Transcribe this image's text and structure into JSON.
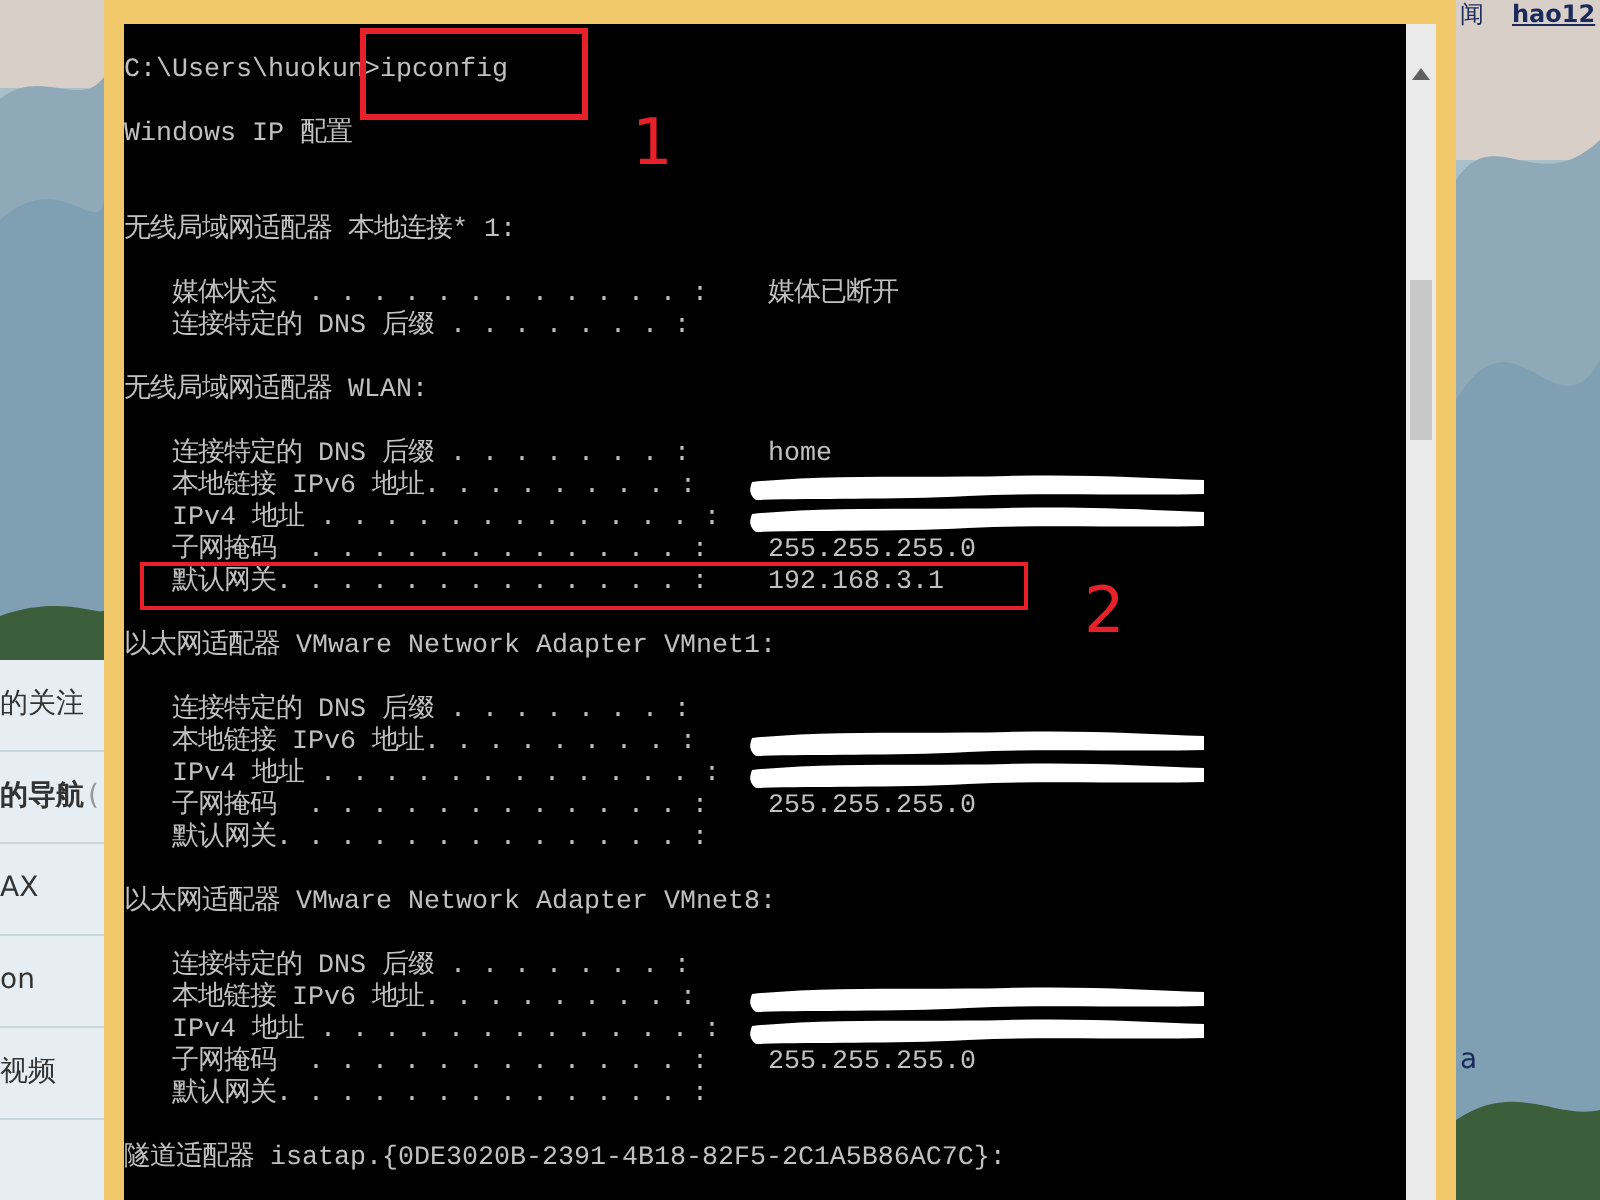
{
  "left_panel": {
    "items": [
      {
        "label": "的关注",
        "bold": false
      },
      {
        "label": "的导航",
        "bold": true,
        "suffix": "("
      },
      {
        "label": "AX",
        "bold": false
      },
      {
        "label": "on",
        "bold": false
      },
      {
        "label": "视频",
        "bold": false
      }
    ]
  },
  "right_panel": {
    "links": [
      {
        "label": "闻",
        "bold": false
      },
      {
        "label": "hao12",
        "bold": true
      }
    ],
    "fragment": "a"
  },
  "console": {
    "prompt": "C:\\Users\\huokun>ipconfig",
    "heading": "Windows IP 配置",
    "adapters": [
      {
        "title": "无线局域网适配器 本地连接* 1:",
        "rows": [
          {
            "label": "媒体状态  . . . . . . . . . . . . :",
            "value": "媒体已断开"
          },
          {
            "label": "连接特定的 DNS 后缀 . . . . . . . :"
          }
        ]
      },
      {
        "title": "无线局域网适配器 WLAN:",
        "rows": [
          {
            "label": "连接特定的 DNS 后缀 . . . . . . . :",
            "value": "home"
          },
          {
            "label": "本地链接 IPv6 地址. . . . . . . . :",
            "redacted": true
          },
          {
            "label": "IPv4 地址 . . . . . . . . . . . . :",
            "redacted": true
          },
          {
            "label": "子网掩码  . . . . . . . . . . . . :",
            "value": "255.255.255.0"
          },
          {
            "label": "默认网关. . . . . . . . . . . . . :",
            "value": "192.168.3.1"
          }
        ]
      },
      {
        "title": "以太网适配器 VMware Network Adapter VMnet1:",
        "rows": [
          {
            "label": "连接特定的 DNS 后缀 . . . . . . . :"
          },
          {
            "label": "本地链接 IPv6 地址. . . . . . . . :",
            "redacted": true
          },
          {
            "label": "IPv4 地址 . . . . . . . . . . . . :",
            "redacted": true
          },
          {
            "label": "子网掩码  . . . . . . . . . . . . :",
            "value": "255.255.255.0"
          },
          {
            "label": "默认网关. . . . . . . . . . . . . :"
          }
        ]
      },
      {
        "title": "以太网适配器 VMware Network Adapter VMnet8:",
        "rows": [
          {
            "label": "连接特定的 DNS 后缀 . . . . . . . :"
          },
          {
            "label": "本地链接 IPv6 地址. . . . . . . . :",
            "redacted": true
          },
          {
            "label": "IPv4 地址 . . . . . . . . . . . . :",
            "redacted": true
          },
          {
            "label": "子网掩码  . . . . . . . . . . . . :",
            "value": "255.255.255.0"
          },
          {
            "label": "默认网关. . . . . . . . . . . . . :"
          }
        ]
      },
      {
        "title": "隧道适配器 isatap.{0DE3020B-2391-4B18-82F5-2C1A5B86AC7C}:"
      }
    ]
  },
  "annotations": [
    {
      "number": "1"
    },
    {
      "number": "2"
    }
  ]
}
